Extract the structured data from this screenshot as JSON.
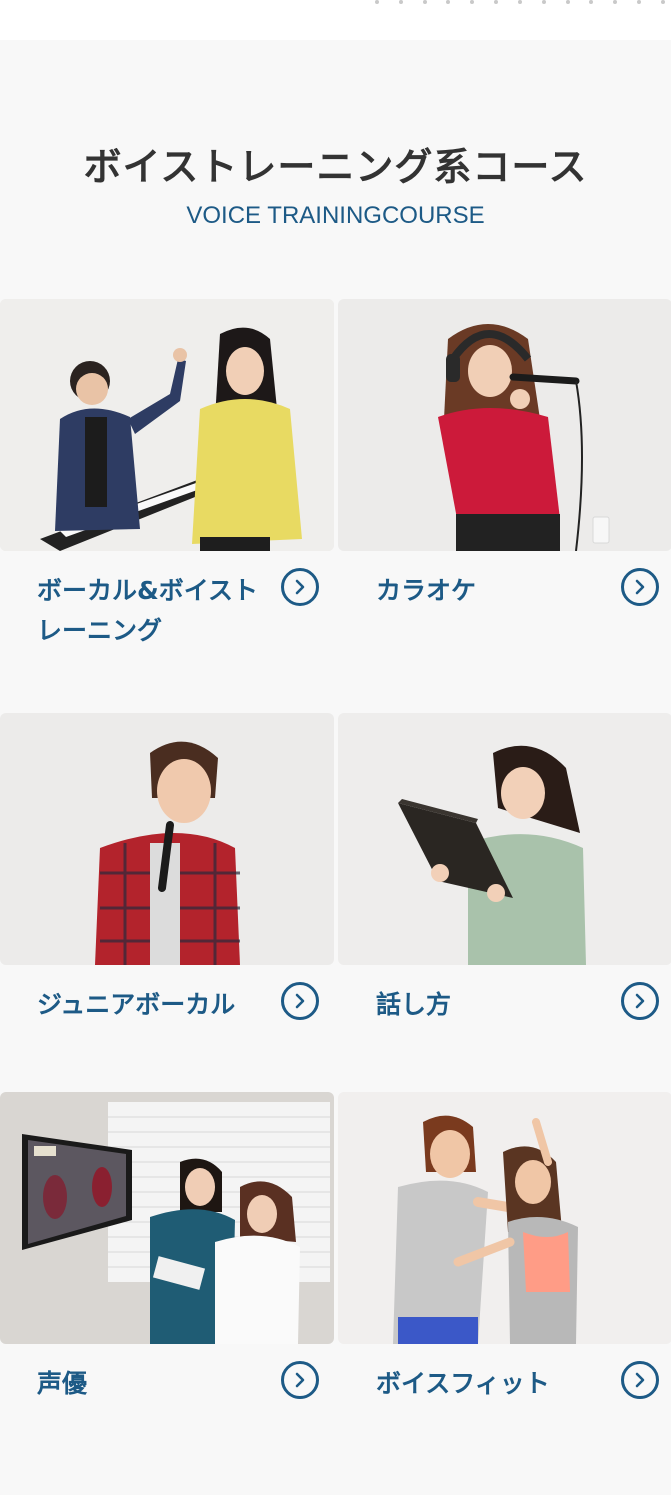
{
  "section": {
    "title": "ボイストレーニング系コース",
    "subtitle": "VOICE TRAININGCOURSE"
  },
  "courses": [
    {
      "label": "ボーカル&ボイストレーニング",
      "image": "vocal-piano-lesson-photo"
    },
    {
      "label": "カラオケ",
      "image": "karaoke-singer-photo"
    },
    {
      "label": "ジュニアボーカル",
      "image": "junior-singer-photo"
    },
    {
      "label": "話し方",
      "image": "speaking-reading-photo"
    },
    {
      "label": "声優",
      "image": "voice-actor-anime-screen-photo"
    },
    {
      "label": "ボイスフィット",
      "image": "voice-fit-exercise-photo"
    }
  ],
  "icons": {
    "arrow": "chevron-right-circle-icon"
  },
  "colors": {
    "accent": "#1d5a86",
    "title": "#333333",
    "background": "#f8f8f8"
  }
}
